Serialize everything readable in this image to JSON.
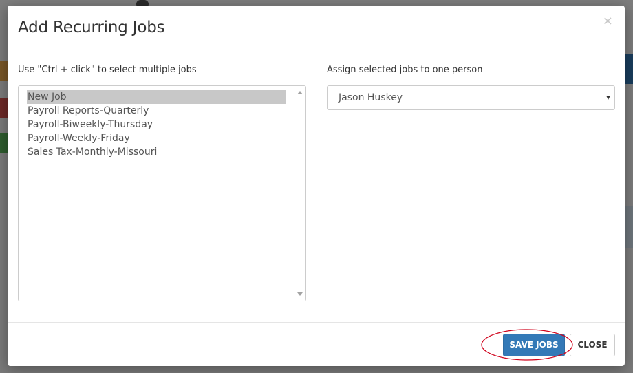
{
  "modal": {
    "title": "Add Recurring Jobs",
    "close_icon": "close-icon"
  },
  "left": {
    "label": "Use \"Ctrl + click\" to select multiple jobs",
    "jobs": [
      "New Job",
      "Payroll Reports-Quarterly",
      "Payroll-Biweekly-Thursday",
      "Payroll-Weekly-Friday",
      "Sales Tax-Monthly-Missouri"
    ],
    "selected_job": "New Job"
  },
  "right": {
    "label": "Assign selected jobs to one person",
    "selected_person": "Jason Huskey"
  },
  "footer": {
    "save_label": "SAVE JOBS",
    "close_label": "CLOSE"
  },
  "colors": {
    "primary": "#3379b7",
    "annotation": "#d0021b",
    "selected_item": "#c8c8c8"
  }
}
